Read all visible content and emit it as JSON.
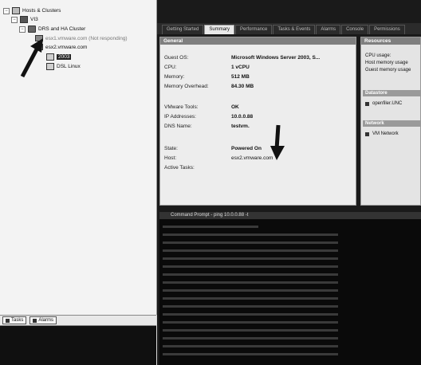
{
  "tree": {
    "root": "Hosts & Clusters",
    "datacenter": "VI3",
    "cluster": "DRS and HA Cluster",
    "host1": "esx1.vmware.com (Not responding)",
    "host2": "esx2.vmware.com",
    "vm_selected": "2003",
    "vm2": "DSL Linux"
  },
  "bottom_tabs": {
    "tasks": "Tasks",
    "alarms": "Alarms"
  },
  "tabs": [
    "Getting Started",
    "Summary",
    "Performance",
    "Tasks & Events",
    "Alarms",
    "Console",
    "Permissions"
  ],
  "general": {
    "header": "General",
    "guest_os_label": "Guest OS:",
    "guest_os_value": "Microsoft Windows Server 2003, S...",
    "cpu_label": "CPU:",
    "cpu_value": "1 vCPU",
    "memory_label": "Memory:",
    "memory_value": "512 MB",
    "memory_overhead_label": "Memory Overhead:",
    "memory_overhead_value": "84.30 MB",
    "vmware_tools_label": "VMware Tools:",
    "vmware_tools_value": "OK",
    "ip_label": "IP Addresses:",
    "ip_value": "10.0.0.88",
    "dns_label": "DNS Name:",
    "dns_value": "testvm.",
    "state_label": "State:",
    "state_value": "Powered On",
    "host_label": "Host:",
    "host_value": "esx2.vmware.com",
    "active_tasks_label": "Active Tasks:"
  },
  "resources": {
    "header": "Resources",
    "cpu_usage": "CPU usage:",
    "host_memory": "Host memory usage",
    "guest_memory": "Guest memory usage",
    "datastore_header": "Datastore",
    "datastore_item": "openfiler.UNC",
    "network_header": "Network",
    "network_item": "VM Network"
  },
  "console": {
    "title": "Command Prompt - ping 10.0.0.88 -t"
  }
}
